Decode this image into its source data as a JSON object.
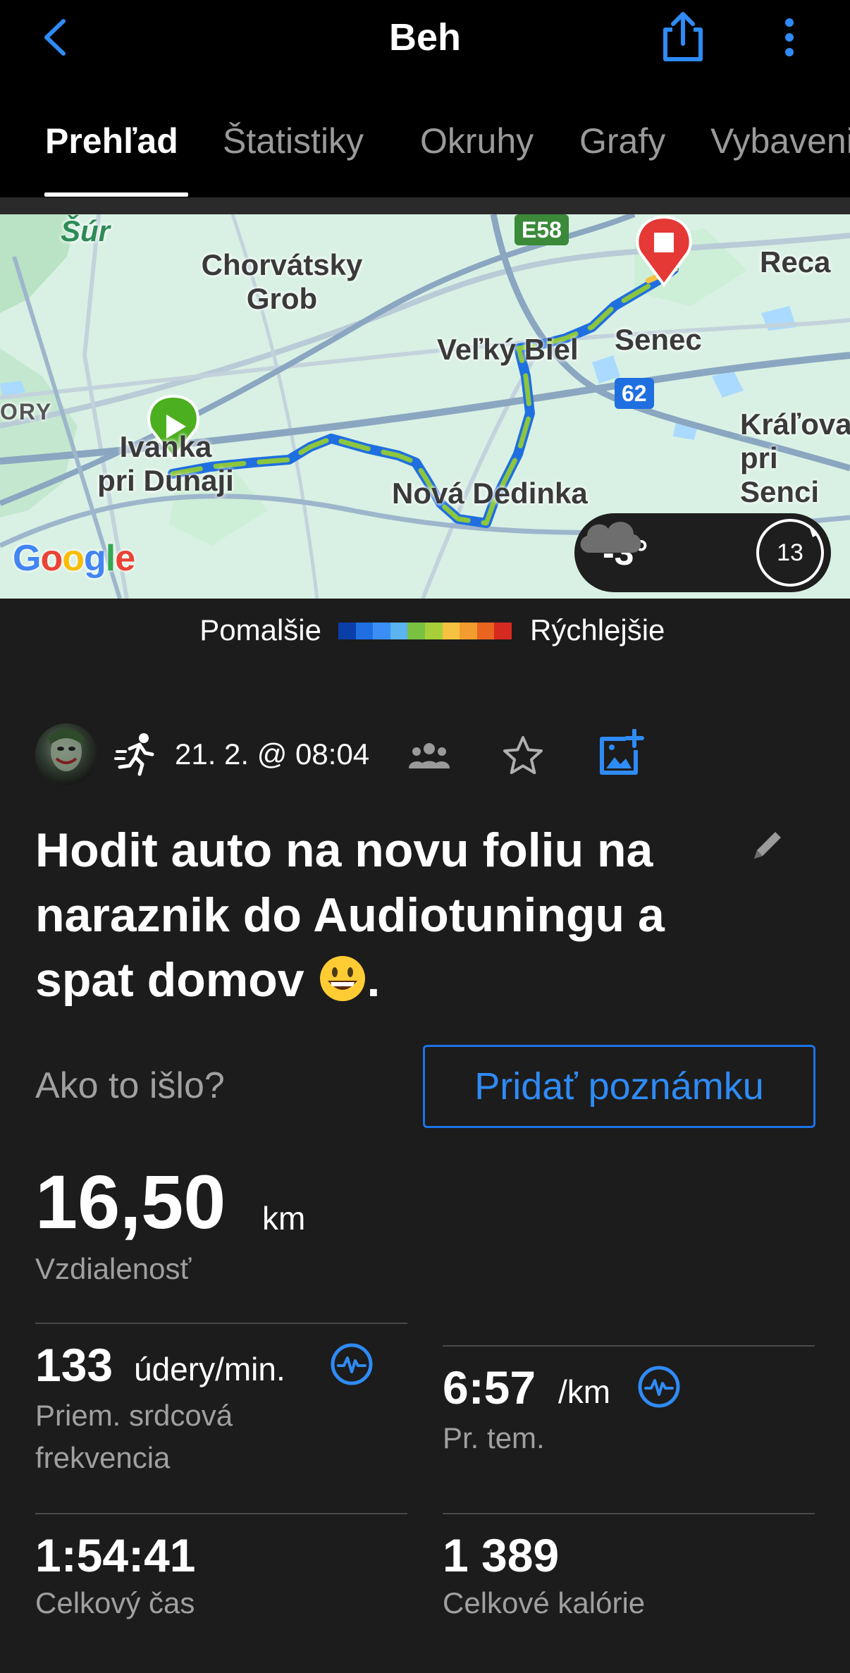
{
  "header": {
    "title": "Beh"
  },
  "tabs": [
    {
      "label": "Prehľad",
      "active": true
    },
    {
      "label": "Štatistiky",
      "active": false
    },
    {
      "label": "Okruhy",
      "active": false
    },
    {
      "label": "Grafy",
      "active": false
    },
    {
      "label": "Vybavenie",
      "active": false
    }
  ],
  "map": {
    "labels": {
      "sur": "Šúr",
      "chorvatsky_grob": "Chorvátsky\nGrob",
      "velky_biel": "Veľký Biel",
      "senec": "Senec",
      "reca": "Reca",
      "ivanka": "Ivanka\npri Dunaji",
      "nova_dedinka": "Nová Dedinka",
      "kralova": "Kráľova\npri Senci",
      "ory": "ORY"
    },
    "shields": {
      "e58": "E58",
      "r62": "62"
    },
    "google": "Google",
    "weather": {
      "temperature": "-3°",
      "wind": "13"
    }
  },
  "legend": {
    "slower": "Pomalšie",
    "faster": "Rýchlejšie",
    "colors": [
      "#0b3fa8",
      "#1f6fe0",
      "#3a8ef5",
      "#5bb3f0",
      "#7ac142",
      "#a8cf3a",
      "#f5c242",
      "#f29b2e",
      "#e8641f",
      "#d42a1f"
    ]
  },
  "activity": {
    "date": "21. 2. @ 08:04",
    "title": "Hodit auto na novu foliu na naraznik do Audiotuningu a spat domov",
    "title_end": ".",
    "how_label": "Ako to išlo?",
    "add_note": "Pridať poznámku"
  },
  "stats": {
    "distance": {
      "value": "16,50",
      "unit": "km",
      "label": "Vzdialenosť"
    },
    "heart_rate": {
      "value": "133",
      "unit": "údery/min.",
      "label": "Priem. srdcová frekvencia"
    },
    "pace": {
      "value": "6:57",
      "unit": "/km",
      "label": "Pr. tem."
    },
    "total_time": {
      "value": "1:54:41",
      "label": "Celkový čas"
    },
    "calories": {
      "value": "1 389",
      "label": "Celkové kalórie"
    }
  }
}
